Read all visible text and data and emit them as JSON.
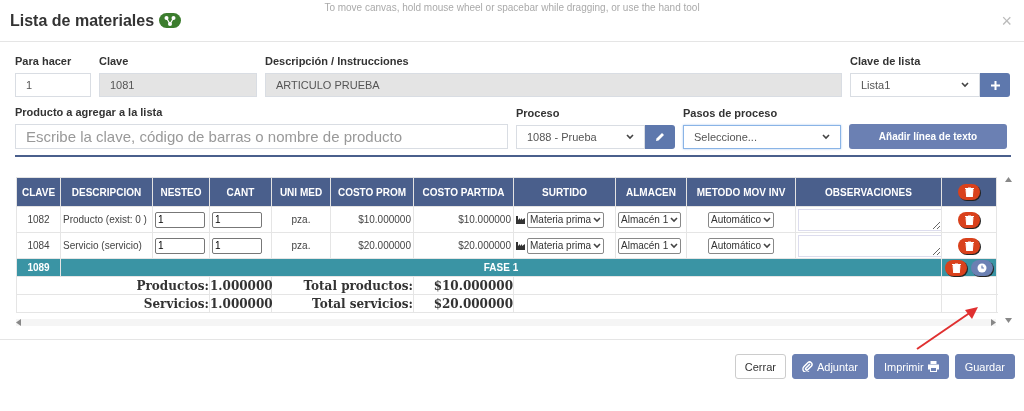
{
  "hint": "To move canvas, hold mouse wheel or spacebar while dragging, or use the hand tool",
  "window": {
    "title": "Lista de materiales",
    "close": "×"
  },
  "form": {
    "para_hacer": {
      "label": "Para hacer",
      "value": "1"
    },
    "clave": {
      "label": "Clave",
      "value": "1081"
    },
    "descripcion": {
      "label": "Descripción / Instrucciones",
      "value": "ARTICULO PRUEBA"
    },
    "clave_lista": {
      "label": "Clave de lista",
      "value": "Lista1"
    },
    "producto": {
      "label": "Producto a agregar a la lista",
      "placeholder": "Escribe la clave, código de barras o nombre de producto"
    },
    "proceso": {
      "label": "Proceso",
      "value": "1088 - Prueba"
    },
    "pasos": {
      "label": "Pasos de proceso",
      "value": "Seleccione...",
      "focused": true
    },
    "add_text_button": "Añadir línea de texto"
  },
  "table": {
    "columns": [
      "CLAVE",
      "DESCRIPCION",
      "NESTEO",
      "CANT",
      "UNI MED",
      "COSTO PROM",
      "COSTO PARTIDA",
      "SURTIDO",
      "ALMACEN",
      "METODO MOV INV",
      "OBSERVACIONES"
    ],
    "rows": [
      {
        "kind": "item",
        "clave": "1082",
        "descripcion": "Producto (exist: 0 )",
        "nesteo": "1",
        "cant": "1",
        "uni_med": "pza.",
        "costo_prom": "$10.000000",
        "costo_partida": "$10.000000",
        "surtido": "Materia prima",
        "almacen": "Almacén 1",
        "metodo": "Automático"
      },
      {
        "kind": "item",
        "clave": "1084",
        "descripcion": "Servicio (servicio)",
        "nesteo": "1",
        "cant": "1",
        "uni_med": "pza.",
        "costo_prom": "$20.000000",
        "costo_partida": "$20.000000",
        "surtido": "Materia prima",
        "almacen": "Almacén 1",
        "metodo": "Automático"
      },
      {
        "kind": "phase",
        "clave": "1089",
        "label": "FASE 1"
      }
    ],
    "totals": [
      {
        "count_label": "Productos:",
        "count": "1.000000",
        "total_label": "Total productos:",
        "total": "$10.000000"
      },
      {
        "count_label": "Servicios:",
        "count": "1.000000",
        "total_label": "Total servicios:",
        "total": "$20.000000"
      }
    ]
  },
  "buttons": [
    {
      "label": "Cerrar",
      "kind": "plain"
    },
    {
      "label": "Adjuntar",
      "kind": "attach"
    },
    {
      "label": "Imprimir",
      "kind": "print"
    },
    {
      "label": "Guardar",
      "kind": "primary"
    }
  ]
}
